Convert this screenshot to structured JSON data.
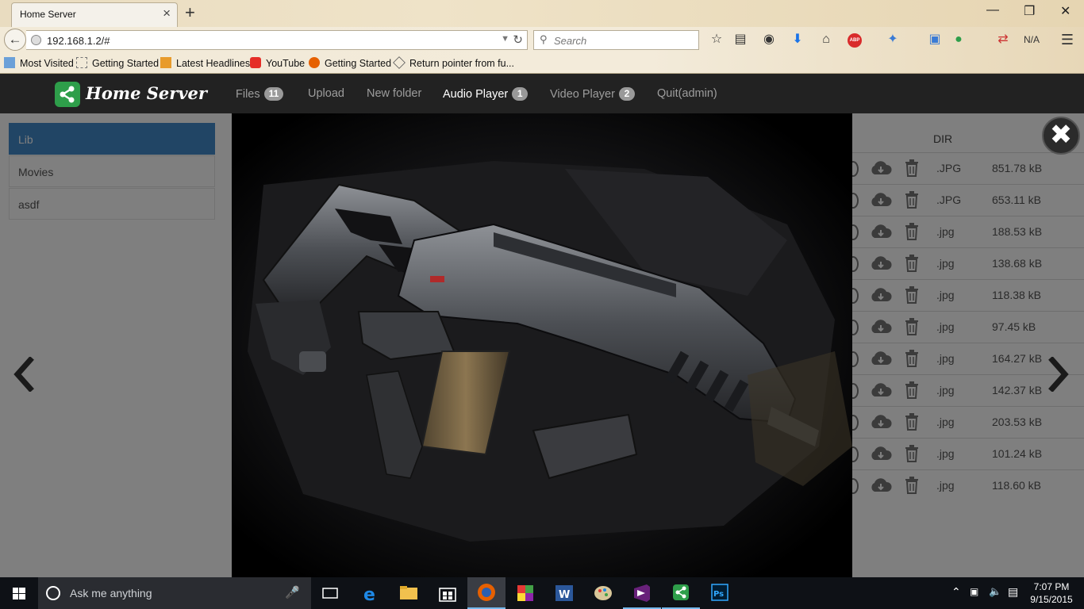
{
  "browser": {
    "tab_title": "Home Server",
    "url": "192.168.1.2/#",
    "search_placeholder": "Search",
    "status_text": "N/A",
    "bookmarks": [
      "Most Visited",
      "Getting Started",
      "Latest Headlines",
      "YouTube",
      "Getting Started",
      "Return pointer from fu..."
    ]
  },
  "app": {
    "brand": "Home Server",
    "nav": [
      {
        "label": "Files",
        "badge": "11"
      },
      {
        "label": "Upload"
      },
      {
        "label": "New folder"
      },
      {
        "label": "Audio Player",
        "badge": "1",
        "active": true
      },
      {
        "label": "Video Player",
        "badge": "2"
      },
      {
        "label": "Quit(admin)"
      }
    ]
  },
  "sidebar": {
    "items": [
      "Lib",
      "Movies",
      "asdf"
    ]
  },
  "files": {
    "dir_header": "DIR",
    "rows": [
      {
        "ext": ".JPG",
        "size": "851.78 kB"
      },
      {
        "ext": ".JPG",
        "size": "653.11 kB"
      },
      {
        "ext": ".jpg",
        "size": "188.53 kB"
      },
      {
        "ext": ".jpg",
        "size": "138.68 kB"
      },
      {
        "ext": ".jpg",
        "size": "118.38 kB"
      },
      {
        "ext": ".jpg",
        "size": "97.45 kB"
      },
      {
        "ext": ".jpg",
        "size": "164.27 kB"
      },
      {
        "ext": ".jpg",
        "size": "142.37 kB"
      },
      {
        "ext": ".jpg",
        "size": "203.53 kB"
      },
      {
        "ext": ".jpg",
        "size": "101.24 kB"
      },
      {
        "ext": ".jpg",
        "size": "118.60 kB"
      }
    ]
  },
  "lightbox": {
    "close_symbol": "✖"
  },
  "taskbar": {
    "search_placeholder": "Ask me anything",
    "time": "7:07 PM",
    "date": "9/15/2015"
  },
  "colors": {
    "app_header": "#222222",
    "brand_green": "#2e9e4a",
    "active_sidebar": "#428bca",
    "taskbar": "#0e1116"
  }
}
